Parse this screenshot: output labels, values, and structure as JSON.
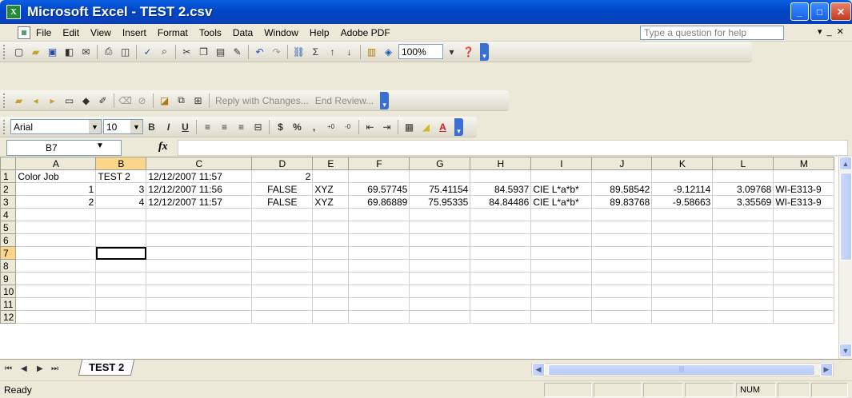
{
  "window": {
    "title": "Microsoft Excel - TEST 2.csv",
    "app_icon": "excel-icon"
  },
  "menu": {
    "items": [
      "File",
      "Edit",
      "View",
      "Insert",
      "Format",
      "Tools",
      "Data",
      "Window",
      "Help",
      "Adobe PDF"
    ],
    "help_placeholder": "Type a question for help"
  },
  "standard_toolbar": {
    "zoom": "100%"
  },
  "reviewing_toolbar": {
    "reply_label": "Reply with Changes...",
    "end_review_label": "End Review..."
  },
  "formatting_toolbar": {
    "font": "Arial",
    "size": "10"
  },
  "formula_bar": {
    "name_box": "B7",
    "fx": "fx",
    "formula": ""
  },
  "sheet": {
    "columns": [
      "A",
      "B",
      "C",
      "D",
      "E",
      "F",
      "G",
      "H",
      "I",
      "J",
      "K",
      "L",
      "M"
    ],
    "rows": [
      [
        "Color Job",
        "TEST 2",
        "12/12/2007 11:57",
        "2",
        "",
        "",
        "",
        "",
        "",
        "",
        "",
        "",
        ""
      ],
      [
        "1",
        "3",
        "12/12/2007 11:56",
        "FALSE",
        "XYZ",
        "69.57745",
        "75.41154",
        "84.5937",
        "CIE L*a*b*",
        "89.58542",
        "-9.12114",
        "3.09768",
        "WI-E313-9"
      ],
      [
        "2",
        "4",
        "12/12/2007 11:57",
        "FALSE",
        "XYZ",
        "69.86889",
        "75.95335",
        "84.84486",
        "CIE L*a*b*",
        "89.83768",
        "-9.58663",
        "3.35569",
        "WI-E313-9"
      ],
      [
        "",
        "",
        "",
        "",
        "",
        "",
        "",
        "",
        "",
        "",
        "",
        "",
        ""
      ],
      [
        "",
        "",
        "",
        "",
        "",
        "",
        "",
        "",
        "",
        "",
        "",
        "",
        ""
      ],
      [
        "",
        "",
        "",
        "",
        "",
        "",
        "",
        "",
        "",
        "",
        "",
        "",
        ""
      ],
      [
        "",
        "",
        "",
        "",
        "",
        "",
        "",
        "",
        "",
        "",
        "",
        "",
        ""
      ],
      [
        "",
        "",
        "",
        "",
        "",
        "",
        "",
        "",
        "",
        "",
        "",
        "",
        ""
      ],
      [
        "",
        "",
        "",
        "",
        "",
        "",
        "",
        "",
        "",
        "",
        "",
        "",
        ""
      ],
      [
        "",
        "",
        "",
        "",
        "",
        "",
        "",
        "",
        "",
        "",
        "",
        "",
        ""
      ],
      [
        "",
        "",
        "",
        "",
        "",
        "",
        "",
        "",
        "",
        "",
        "",
        "",
        ""
      ],
      [
        "",
        "",
        "",
        "",
        "",
        "",
        "",
        "",
        "",
        "",
        "",
        "",
        ""
      ]
    ],
    "row_numbers": [
      "1",
      "2",
      "3",
      "4",
      "5",
      "6",
      "7",
      "8",
      "9",
      "10",
      "11",
      "12"
    ],
    "active_cell": "B7",
    "selected_column": "B",
    "selected_row": "7",
    "tab_name": "TEST 2"
  },
  "status": {
    "text": "Ready",
    "num": "NUM"
  }
}
